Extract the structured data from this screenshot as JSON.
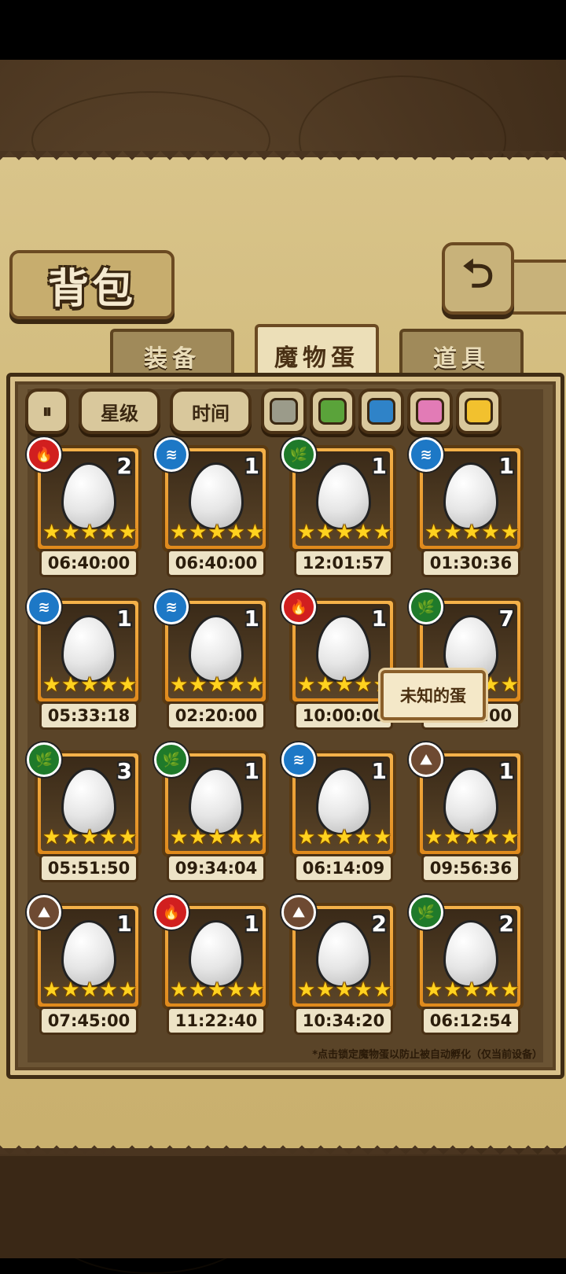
{
  "title": "背包",
  "back_icon": "back-arrow-icon",
  "tabs": [
    {
      "label": "装备",
      "active": false
    },
    {
      "label": "魔物蛋",
      "active": true
    },
    {
      "label": "道具",
      "active": false
    }
  ],
  "filters": {
    "sort_icon": "sort-toggle-icon",
    "star_label": "星级",
    "time_label": "时间",
    "swatches": [
      "#9b9b8a",
      "#5aa33a",
      "#2f83c8",
      "#e27bb6",
      "#f2c12e"
    ]
  },
  "eggs": [
    {
      "element": "fire",
      "count": "2",
      "stars": 5,
      "time": "06:40:00",
      "icon": "🥚"
    },
    {
      "element": "water",
      "count": "1",
      "stars": 5,
      "time": "06:40:00",
      "icon": "🥚"
    },
    {
      "element": "leaf",
      "count": "1",
      "stars": 5,
      "time": "12:01:57",
      "icon": "🥚"
    },
    {
      "element": "water",
      "count": "1",
      "stars": 5,
      "time": "01:30:36",
      "icon": "🥚"
    },
    {
      "element": "water",
      "count": "1",
      "stars": 5,
      "time": "05:33:18",
      "icon": "🥚"
    },
    {
      "element": "water",
      "count": "1",
      "stars": 5,
      "time": "02:20:00",
      "icon": "🥚"
    },
    {
      "element": "fire",
      "count": "1",
      "stars": 5,
      "time": "10:00:00",
      "icon": "🥚"
    },
    {
      "element": "leaf",
      "count": "7",
      "stars": 5,
      "time": "11:40:00",
      "icon": "🥚"
    },
    {
      "element": "leaf",
      "count": "3",
      "stars": 5,
      "time": "05:51:50",
      "icon": "🥚"
    },
    {
      "element": "leaf",
      "count": "1",
      "stars": 5,
      "time": "09:34:04",
      "icon": "🥚"
    },
    {
      "element": "water",
      "count": "1",
      "stars": 5,
      "time": "06:14:09",
      "icon": "🥚"
    },
    {
      "element": "earth",
      "count": "1",
      "stars": 5,
      "time": "09:56:36",
      "icon": "🥚"
    },
    {
      "element": "earth",
      "count": "1",
      "stars": 5,
      "time": "07:45:00",
      "icon": "🥚"
    },
    {
      "element": "fire",
      "count": "1",
      "stars": 5,
      "time": "11:22:40",
      "icon": "🥚"
    },
    {
      "element": "earth",
      "count": "2",
      "stars": 5,
      "time": "10:34:20",
      "icon": "🥚"
    },
    {
      "element": "leaf",
      "count": "2",
      "stars": 5,
      "time": "06:12:54",
      "icon": "🥚"
    }
  ],
  "tooltip": "未知的蛋",
  "note": "*点击锁定魔物蛋以防止被自动孵化（仅当前设备）"
}
